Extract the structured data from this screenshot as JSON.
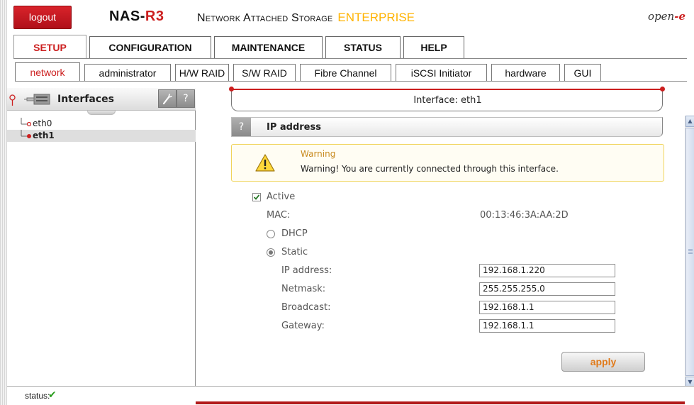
{
  "header": {
    "logout_label": "logout",
    "brand_prefix": "NAS-",
    "brand_suffix": "R3",
    "subtitle": "Network Attached Storage",
    "edition": "ENTERPRISE",
    "vendor_prefix": "open",
    "vendor_suffix": "e"
  },
  "main_tabs": [
    {
      "label": "SETUP",
      "active": true
    },
    {
      "label": "CONFIGURATION",
      "active": false
    },
    {
      "label": "MAINTENANCE",
      "active": false
    },
    {
      "label": "STATUS",
      "active": false
    },
    {
      "label": "HELP",
      "active": false
    }
  ],
  "sub_tabs": [
    {
      "label": "network",
      "active": true
    },
    {
      "label": "administrator",
      "active": false
    },
    {
      "label": "H/W RAID",
      "active": false
    },
    {
      "label": "S/W RAID",
      "active": false
    },
    {
      "label": "Fibre Channel",
      "active": false
    },
    {
      "label": "iSCSI Initiator",
      "active": false
    },
    {
      "label": "hardware",
      "active": false
    },
    {
      "label": "GUI",
      "active": false
    }
  ],
  "left_panel": {
    "title": "Interfaces",
    "tool_icon": "wrench-icon",
    "help_label": "?",
    "items": [
      {
        "label": "eth0",
        "selected": false
      },
      {
        "label": "eth1",
        "selected": true
      }
    ]
  },
  "main": {
    "interface_title": "Interface: eth1",
    "section_help": "?",
    "section_title": "IP address",
    "warning": {
      "title": "Warning",
      "text": "Warning! You are currently connected through this interface.",
      "icon": "warning-triangle-icon"
    },
    "active_label": "Active",
    "active_checked": true,
    "mac_label": "MAC:",
    "mac_value": "00:13:46:3A:AA:2D",
    "dhcp_label": "DHCP",
    "static_label": "Static",
    "mode_selected": "Static",
    "ip_label": "IP address:",
    "ip_value": "192.168.1.220",
    "netmask_label": "Netmask:",
    "netmask_value": "255.255.255.0",
    "broadcast_label": "Broadcast:",
    "broadcast_value": "192.168.1.1",
    "gateway_label": "Gateway:",
    "gateway_value": "192.168.1.1",
    "apply_label": "apply"
  },
  "status_bar": {
    "label": "status:",
    "icon": "checkmark-icon",
    "symbol": "✔"
  },
  "colors": {
    "brand_red": "#cc1f1f",
    "edition_yellow": "#ffb300",
    "apply_orange": "#e07a1a",
    "warning_border": "#f0d45a",
    "status_green": "#2a9d1e"
  }
}
